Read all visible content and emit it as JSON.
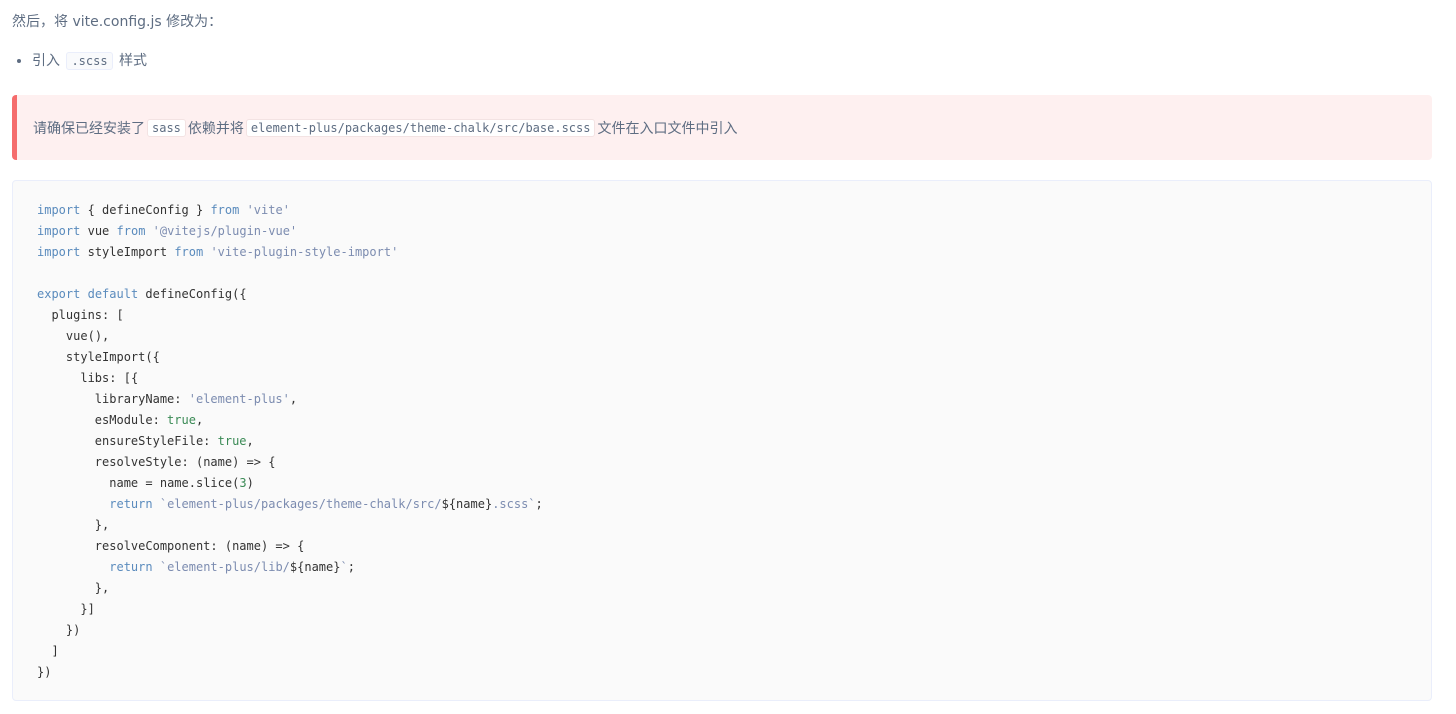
{
  "intro": {
    "text": "然后，将 vite.config.js 修改为："
  },
  "bullets": [
    {
      "before": "引入",
      "code": ".scss",
      "after": "样式"
    }
  ],
  "tip": {
    "part1": "请确保已经安装了",
    "code1": "sass",
    "part2": "依赖并将",
    "code2": "element-plus/packages/theme-chalk/src/base.scss",
    "part3": "文件在入口文件中引入",
    "border_color": "#f56c6c",
    "background_color": "#fef0f0"
  },
  "code_block": {
    "lines": [
      "import { defineConfig } from 'vite'",
      "import vue from '@vitejs/plugin-vue'",
      "import styleImport from 'vite-plugin-style-import'",
      "",
      "export default defineConfig({",
      "  plugins: [",
      "    vue(),",
      "    styleImport({",
      "      libs: [{",
      "        libraryName: 'element-plus',",
      "        esModule: true,",
      "        ensureStyleFile: true,",
      "        resolveStyle: (name) => {",
      "          name = name.slice(3)",
      "          return `element-plus/packages/theme-chalk/src/${name}.scss`;",
      "        },",
      "        resolveComponent: (name) => {",
      "          return `element-plus/lib/${name}`;",
      "        },",
      "      }]",
      "    })",
      "  ]",
      "})"
    ],
    "keyword_color": "#5a8bbd",
    "string_color": "#7c8cb0",
    "literal_color": "#3a8a55"
  }
}
